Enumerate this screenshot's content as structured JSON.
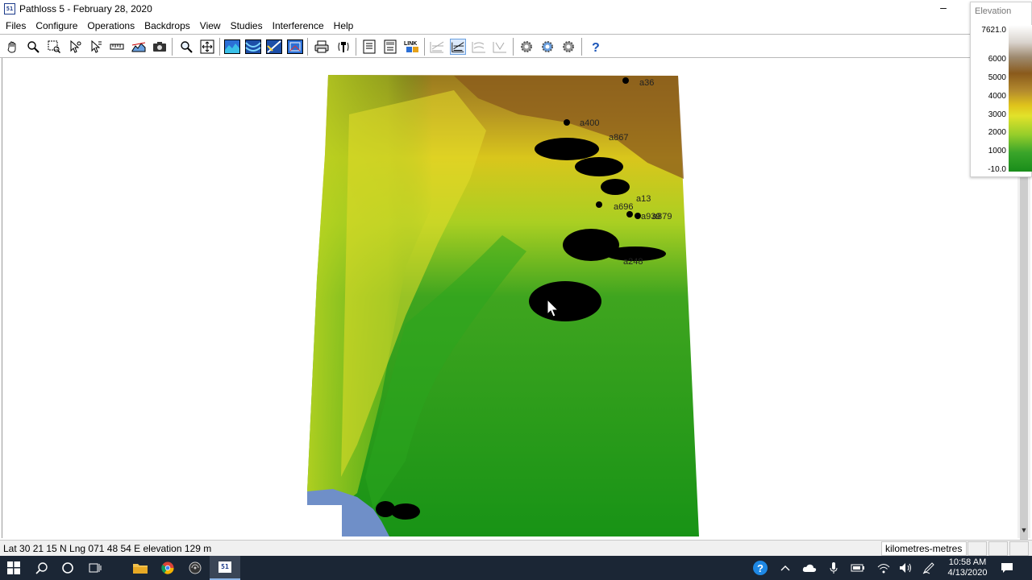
{
  "window": {
    "title": "Pathloss 5 - February 28, 2020",
    "app_icon_text": "51"
  },
  "menu": [
    "Files",
    "Configure",
    "Operations",
    "Backdrops",
    "View",
    "Studies",
    "Interference",
    "Help"
  ],
  "toolbar": {
    "buttons": [
      "pan-icon",
      "zoom-icon",
      "select-area-icon",
      "pointer-icon",
      "multi-pointer-icon",
      "measure-icon",
      "profile-icon",
      "camera-icon",
      "magnify-icon",
      "fit-icon",
      "backdrop-1-icon",
      "backdrop-2-icon",
      "backdrop-3-icon",
      "backdrop-4-icon",
      "print-icon",
      "antenna-icon",
      "report-1-icon",
      "report-2-icon",
      "link-icon",
      "network-1-icon",
      "network-2-icon",
      "network-3-icon",
      "network-4-icon",
      "gear-1-icon",
      "gear-2-icon",
      "gear-3-icon",
      "help-icon"
    ],
    "link_label": "LINK"
  },
  "legend": {
    "title": "Elevation",
    "ticks": [
      "7621.0",
      "6000",
      "5000",
      "4000",
      "3000",
      "2000",
      "1000",
      "-10.0"
    ]
  },
  "map": {
    "site_labels": [
      "a36",
      "a400",
      "a867",
      "a13",
      "a696",
      "a939",
      "a879",
      "a248"
    ]
  },
  "status": {
    "coords": "Lat 30 21 15 N   Lng 071 48 54 E   elevation 129 m",
    "units": "kilometres-metres"
  },
  "taskbar": {
    "time": "10:58 AM",
    "date": "4/13/2020",
    "app_badge": "51"
  },
  "colors": {
    "taskbar": "#1b2635",
    "sea": "#6f8fc8",
    "lowland": "#159a15",
    "plateau": "#e0dc1e",
    "mountain": "#8a5a1c"
  }
}
